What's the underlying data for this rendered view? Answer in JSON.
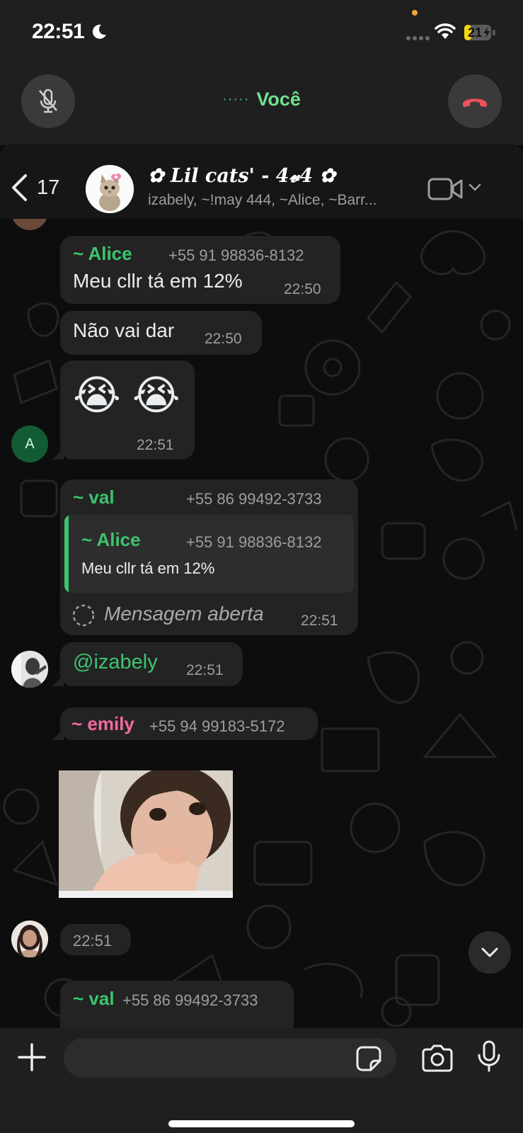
{
  "status_bar": {
    "time": "22:51",
    "battery": "21"
  },
  "call": {
    "label": "Você",
    "dots": "·····"
  },
  "header": {
    "back_count": "17",
    "group_title": "✿ 𝑳𝒊𝒍 𝒄𝒂𝒕𝒔' - 4𝓿4 ✿",
    "members": "izabely, ~!may 444, ~Alice, ~Barr..."
  },
  "messages": [
    {
      "sender": "~ Alice",
      "phone": "+55 91 98836-8132",
      "text": "Meu cllr tá em 12%",
      "time": "22:50"
    },
    {
      "text": "Não vai dar",
      "time": "22:50"
    },
    {
      "text": "😭 😭",
      "time": "22:51",
      "avatar_letter": "A"
    },
    {
      "sender": "~ val",
      "phone": "+55 86 99492-3733",
      "quote": {
        "sender": "~ Alice",
        "phone": "+55 91 98836-8132",
        "text": "Meu cllr tá em 12%"
      },
      "text": "Mensagem aberta",
      "time": "22:51"
    },
    {
      "text": "@izabely",
      "time": "22:51"
    },
    {
      "sender": "~ emily",
      "phone": "+55 94 99183-5172",
      "time": "22:51"
    },
    {
      "sender": "~ val",
      "phone": "+55 86 99492-3733"
    }
  ],
  "input": {
    "placeholder": ""
  },
  "colors": {
    "accent_green": "#3cc46e",
    "sender_pink": "#f26aa0",
    "end_call_red": "#f0505a",
    "bubble": "#232323"
  },
  "icons": [
    "moon-icon",
    "signal-icon",
    "wifi-icon",
    "battery-icon",
    "mute-mic-icon",
    "end-call-icon",
    "back-chevron-icon",
    "video-camera-icon",
    "chevron-down-icon",
    "plus-icon",
    "sticker-icon",
    "camera-icon",
    "mic-icon"
  ]
}
